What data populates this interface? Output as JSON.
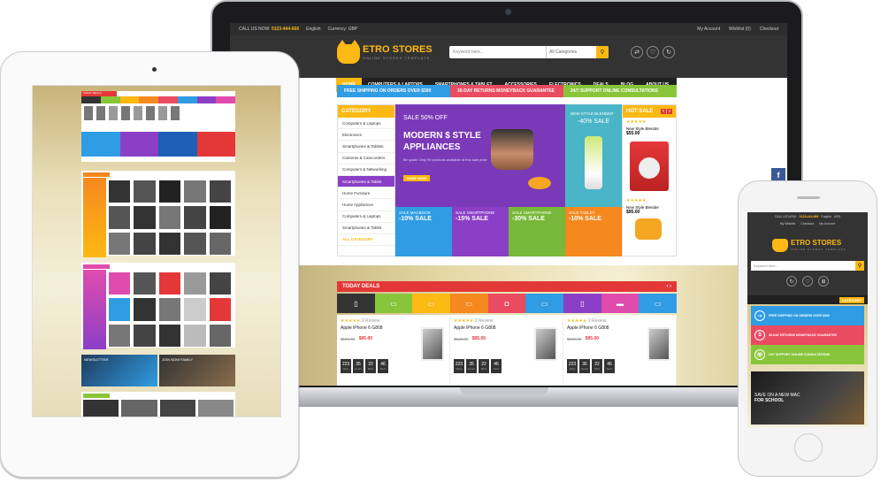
{
  "laptop": {
    "topbar": {
      "call_label": "CALL US NOW:",
      "phone": "0123-444-666",
      "language": "English",
      "currency": "Currency: GBP",
      "account": "My Account",
      "wishlist": "Wishlist (0)",
      "checkout": "Checkout"
    },
    "logo": {
      "name": "ETRO STORES",
      "tagline": "ONLINE STORES TEMPLATE"
    },
    "search": {
      "placeholder": "Keyword here...",
      "category": "All Categories"
    },
    "nav": [
      "HOME",
      "COMPUTERS & LAPTOPS",
      "SMARTPHONES & TABLET",
      "ACCESSORIES",
      "ELECTRONICS",
      "DEALS",
      "BLOG",
      "ABOUT US"
    ],
    "strips": [
      {
        "text": "FREE SHIPPING ON ORDERS OVER $300",
        "color": "#2f9ce3"
      },
      {
        "text": "30-DAY RETURNS MONEYBACK GUARANTEE",
        "color": "#e94b61"
      },
      {
        "text": "24/7 SUPPORT ONLINE CONSULTATIONS",
        "color": "#88c53a"
      }
    ],
    "category": {
      "title": "CATEGORY",
      "items": [
        "Computers & Laptops",
        "Electronics",
        "Smartphones & Tablets",
        "Cameras & Camcorders",
        "Computers & Networking",
        "Smartphones & Tablet",
        "Home Furniture",
        "Home Appliances",
        "Computers & Laptops",
        "Smartphones & Tablet"
      ],
      "all": "ALL CATEGORY"
    },
    "slider": {
      "sale": "SALE 50% OFF",
      "title1": "MODERN $ STYLE",
      "title2": "APPLIANCES",
      "desc": "Be quick! Only 90 products available at this sale price",
      "button": "SHOP NOW"
    },
    "blender": {
      "title": "NEW STYLE BLENDER",
      "sale": "-40% SALE"
    },
    "hot_sale": {
      "title": "HOT SALE",
      "products": [
        {
          "name": "New Style Blender",
          "price": "$55.00"
        },
        {
          "name": "New Style Blender",
          "price": "$95.00"
        }
      ]
    },
    "tiles": [
      {
        "label": "SALE MACBOOK",
        "sale": "-10% SALE",
        "color": "#2f9ce3"
      },
      {
        "label": "SALE SMARTPHONE",
        "sale": "-15% SALE",
        "color": "#8b3fc6"
      },
      {
        "label": "SALE SMARTPHONE",
        "sale": "-30% SALE",
        "color": "#78b83a"
      },
      {
        "label": "SALE TABLET",
        "sale": "-10% SALE",
        "color": "#f5881f"
      }
    ],
    "deals": {
      "title": "TODAY DEALS",
      "icon_colors": [
        "#333333",
        "#88c53a",
        "#fdb913",
        "#f5881f",
        "#e94b61",
        "#2f9ce3",
        "#8b3fc6",
        "#e04cad",
        "#2f9ce3"
      ],
      "products": [
        {
          "reviews": "2 Review",
          "name": "Apple iPhone 6 G808",
          "old": "$120.00",
          "price": "$95.00",
          "cd": [
            "223",
            "35",
            "22",
            "46"
          ]
        },
        {
          "reviews": "2 Review",
          "name": "Apple iPhone 6 G808",
          "old": "$120.00",
          "price": "$95.00",
          "cd": [
            "223",
            "35",
            "22",
            "46"
          ]
        },
        {
          "reviews": "2 Review",
          "name": "Apple iPhone 6 G808",
          "old": "$120.00",
          "price": "$95.00",
          "cd": [
            "223",
            "35",
            "22",
            "46"
          ]
        }
      ],
      "cd_labels": [
        "Days",
        "Hours",
        "Mins",
        "Secs"
      ]
    }
  },
  "tablet": {
    "deals_title": "TODAY DEALS",
    "newsletter": "NEWSLETTER",
    "join": "JOIN NOW FAMILY"
  },
  "phone": {
    "call_label": "CALL US NOW:",
    "phone": "0123-444-666",
    "language": "English",
    "currency": "USD",
    "wishlist": "My Wishlist",
    "checkout": "Checkout",
    "account": "My Account",
    "logo": "ETRO STORES",
    "tagline": "ONLINE STORES TEMPLATE",
    "search_placeholder": "Keyword here...",
    "category": "CATEGORY",
    "strips": [
      "FREE SHIPPING ON ORDERS OVER $300",
      "30-DAY RETURNS MONEYBACK GUARANTEE",
      "24/7 SUPPORT ONLINE CONSULTATIONS"
    ],
    "promo": {
      "line1": "SAVE ON A NEW MAC",
      "line2": "FOR SCHOOL"
    }
  },
  "facebook": "f"
}
